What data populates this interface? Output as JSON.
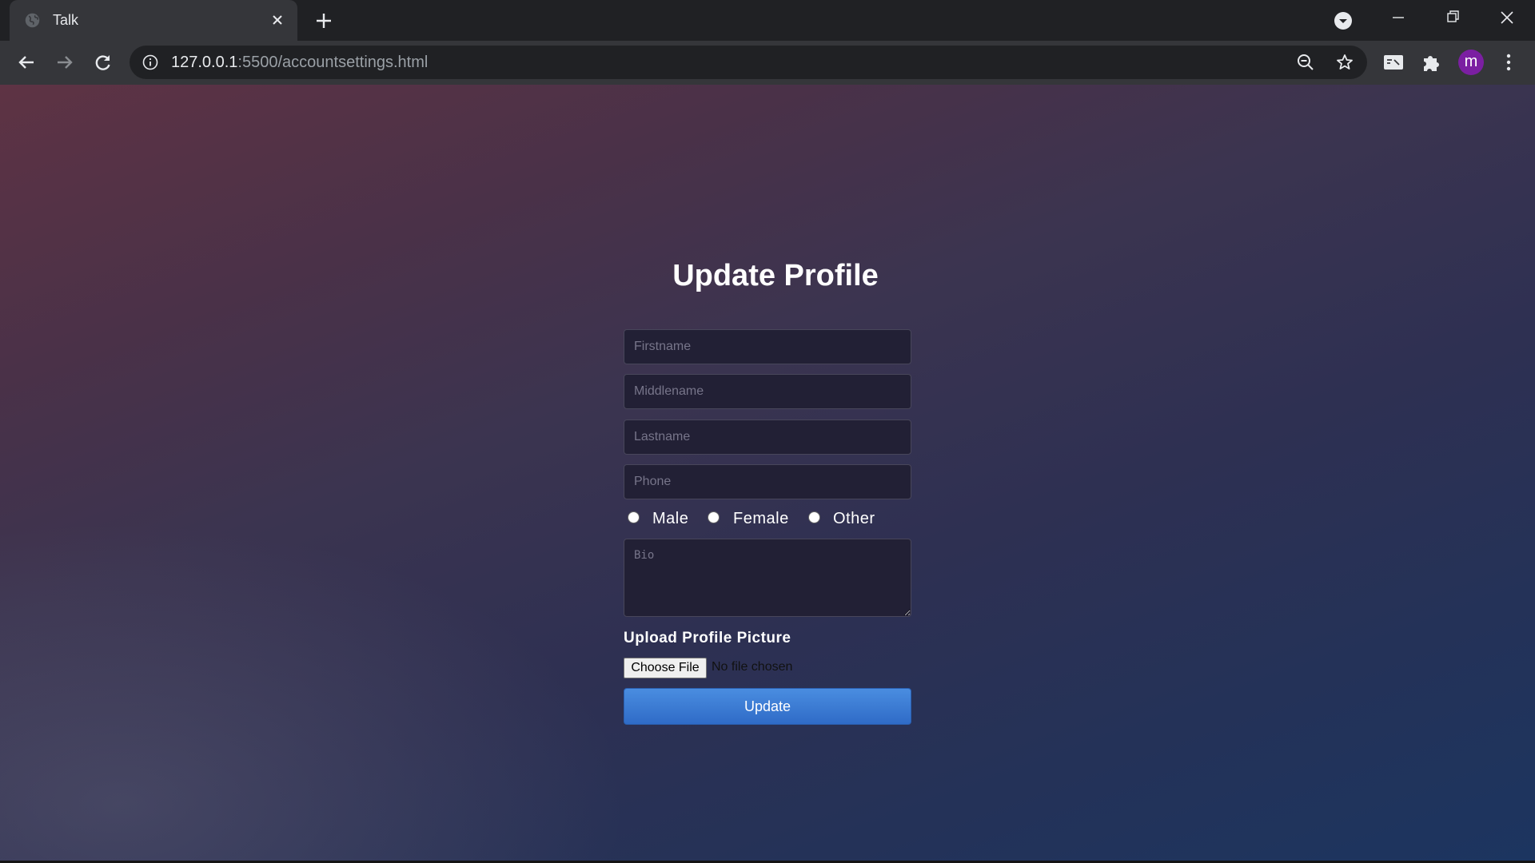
{
  "browser": {
    "tab_title": "Talk",
    "url_host": "127.0.0.1",
    "url_path": ":5500/accountsettings.html",
    "profile_initial": "m"
  },
  "page": {
    "title": "Update Profile",
    "fields": {
      "firstname_placeholder": "Firstname",
      "middlename_placeholder": "Middlename",
      "lastname_placeholder": "Lastname",
      "phone_placeholder": "Phone",
      "bio_placeholder": "Bio"
    },
    "gender": {
      "options": [
        "Male",
        "Female",
        "Other"
      ],
      "selected": null
    },
    "upload": {
      "label": "Upload Profile Picture",
      "button_label": "Choose File",
      "status": "No file chosen"
    },
    "update_button_label": "Update"
  },
  "colors": {
    "accent": "#3a7bd5",
    "avatar": "#7b1fa2"
  }
}
